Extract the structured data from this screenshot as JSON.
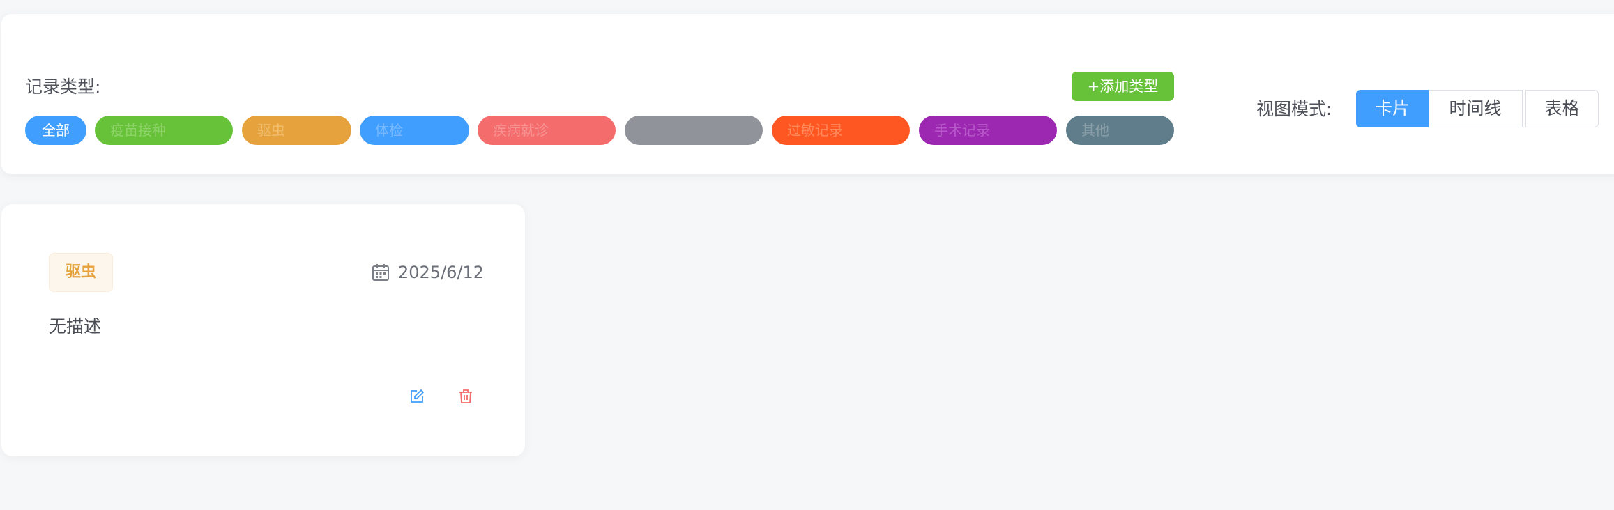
{
  "filters": {
    "label": "记录类型:",
    "add_type_button": "+添加类型",
    "chips": [
      {
        "label": "全部",
        "bg": "#409eff",
        "color": "#ffffff",
        "active": true
      },
      {
        "label": "疫苗接种",
        "bg": "#67c23a",
        "color": "#8fd46a"
      },
      {
        "label": "驱虫",
        "bg": "#e6a23c",
        "color": "#f0bd6e"
      },
      {
        "label": "体检",
        "bg": "#409eff",
        "color": "#79b8ff"
      },
      {
        "label": "疾病就诊",
        "bg": "#f56c6c",
        "color": "#f79595"
      },
      {
        "label": "",
        "bg": "#909399",
        "color": "#909399"
      },
      {
        "label": "过敏记录",
        "bg": "#ff5722",
        "color": "#ff8a5e"
      },
      {
        "label": "手术记录",
        "bg": "#9c27b0",
        "color": "#b75ac9"
      },
      {
        "label": "其他",
        "bg": "#607d8b",
        "color": "#8a9ea8"
      }
    ]
  },
  "view_mode": {
    "label": "视图模式:",
    "options": [
      "卡片",
      "时间线",
      "表格"
    ],
    "active": "卡片"
  },
  "records": [
    {
      "type": "驱虫",
      "date": "2025/6/12",
      "description": "无描述",
      "icons": {
        "date": "calendar-icon",
        "edit": "edit-icon",
        "delete": "delete-icon"
      },
      "colors": {
        "edit": "#409eff",
        "delete": "#f56c6c"
      }
    }
  ]
}
